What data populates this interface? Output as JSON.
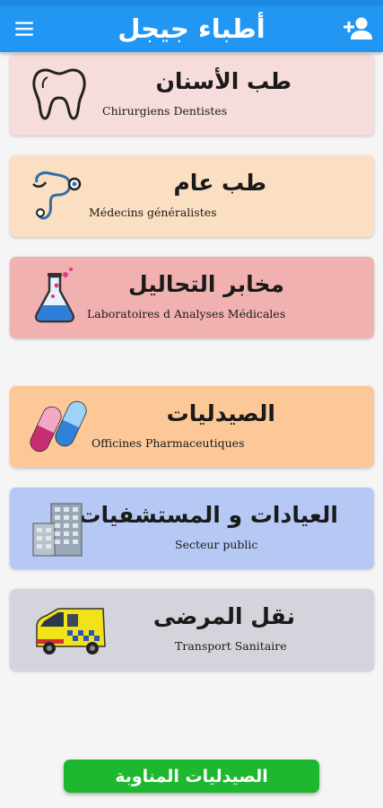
{
  "app_bar": {
    "title": "أطباء جيجل",
    "menu_icon": "menu-icon",
    "add_user_icon": "person-add-icon",
    "color": "#2196f3"
  },
  "categories": [
    {
      "title_ar": "طب الأسنان",
      "title_fr": "Chirurgiens Dentistes",
      "icon": "tooth-icon",
      "bg": "#f7dcdc"
    },
    {
      "title_ar": "طب عام",
      "title_fr": "Médecins généralistes",
      "icon": "stethoscope-icon",
      "bg": "#fbdfc2"
    },
    {
      "title_ar": "مخابر التحاليل",
      "title_fr": "Laboratoires d Analyses Médicales",
      "icon": "flask-icon",
      "bg": "#f2b1b1"
    },
    {
      "title_ar": "الصيدليات",
      "title_fr": "Officines Pharmaceutiques",
      "icon": "pill-icon",
      "bg": "#fcc897"
    },
    {
      "title_ar": "العيادات و المستشفيات",
      "title_fr": "Secteur public",
      "icon": "hospital-building-icon",
      "bg": "#b6c9f5"
    },
    {
      "title_ar": "نقل المرضى",
      "title_fr": "Transport Sanitaire",
      "icon": "ambulance-icon",
      "bg": "#d4d4dc"
    }
  ],
  "bottom_button": {
    "label": "الصيدليات المناوبة",
    "color": "#1db82f"
  }
}
